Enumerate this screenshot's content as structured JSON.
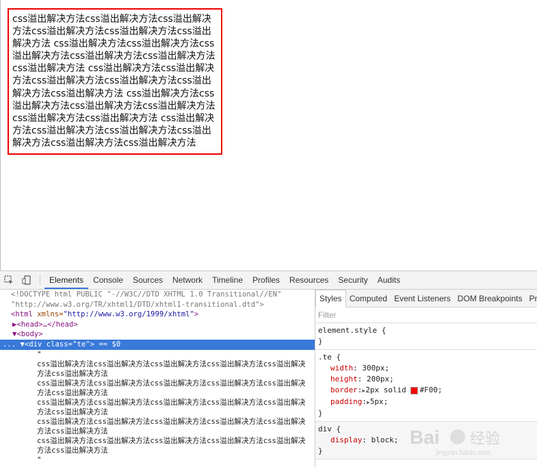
{
  "page": {
    "te_text": "css溢出解决方法css溢出解决方法css溢出解决方法css溢出解决方法css溢出解决方法css溢出解决方法 css溢出解决方法css溢出解决方法css溢出解决方法css溢出解决方法css溢出解决方法css溢出解决方法 css溢出解决方法css溢出解决方法css溢出解决方法css溢出解决方法css溢出解决方法css溢出解决方法 css溢出解决方法css溢出解决方法css溢出解决方法css溢出解决方法css溢出解决方法css溢出解决方法 css溢出解决方法css溢出解决方法css溢出解决方法css溢出解决方法css溢出解决方法css溢出解决方法"
  },
  "devtools": {
    "tabs": [
      "Elements",
      "Console",
      "Sources",
      "Network",
      "Timeline",
      "Profiles",
      "Resources",
      "Security",
      "Audits"
    ],
    "active_tab": "Elements",
    "dom": {
      "doctype1": "<!DOCTYPE html PUBLIC \"-//W3C//DTD XHTML 1.0 Transitional//EN\"",
      "doctype2": "\"http://www.w3.org/TR/xhtml1/DTD/xhtml1-transitional.dtd\">",
      "html_open": "<html",
      "html_attr": " xmlns=",
      "html_val": "\"http://www.w3.org/1999/xhtml\"",
      "html_close": ">",
      "head": "▶<head>…</head>",
      "body": "▼<body>",
      "sel_prefix": "... ▼<div",
      "sel_attr": " class=",
      "sel_val": "\"te\"",
      "sel_suffix": "> == $0",
      "quote": "\"",
      "text_lines": [
        "css溢出解决方法css溢出解决方法css溢出解决方法css溢出解决方法css溢出解决方法css溢出解决方法",
        "css溢出解决方法css溢出解决方法css溢出解决方法css溢出解决方法css溢出解决方法css溢出解决方法",
        "css溢出解决方法css溢出解决方法css溢出解决方法css溢出解决方法css溢出解决方法css溢出解决方法",
        "css溢出解决方法css溢出解决方法css溢出解决方法css溢出解决方法css溢出解决方法css溢出解决方法",
        "css溢出解决方法css溢出解决方法css溢出解决方法css溢出解决方法css溢出解决方法css溢出解决方法"
      ]
    },
    "styles": {
      "tabs": [
        "Styles",
        "Computed",
        "Event Listeners",
        "DOM Breakpoints",
        "Pro"
      ],
      "active_tab": "Styles",
      "filter_placeholder": "Filter",
      "element_style": "element.style {",
      "close_brace": "}",
      "te_selector": ".te {",
      "te_props": [
        {
          "name": "width",
          "value": "300px;"
        },
        {
          "name": "height",
          "value": "200px;"
        },
        {
          "name": "border",
          "value": "2px solid",
          "color": "#F00;"
        },
        {
          "name": "padding",
          "value": "5px;"
        }
      ],
      "div_selector": "div {",
      "div_prop": {
        "name": "display",
        "value": "block;"
      }
    },
    "colors": {
      "accent": "#3879d9",
      "border_red": "#F00"
    }
  },
  "watermark": {
    "brand": "Bai",
    "brand2": "经验",
    "url": "jingyan.baidu.com"
  }
}
